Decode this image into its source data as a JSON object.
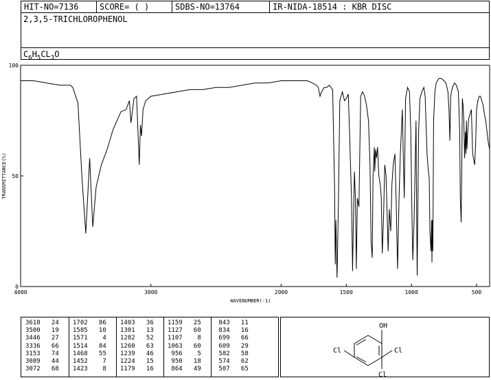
{
  "header": {
    "hit_no": "HIT-NO=7136",
    "score": "SCORE=  (   )",
    "sdbs_no": "SDBS-NO=13764",
    "ir_info": "IR-NIDA-18514 : KBR DISC"
  },
  "compound": {
    "name": "2,3,5-TRICHLOROPHENOL",
    "formula_parts": [
      "C",
      "6",
      "H",
      "5",
      "CL",
      "3",
      "O"
    ]
  },
  "structure": {
    "oh_label": "OH",
    "cl_labels": [
      "Cl",
      "Cl",
      "Cl"
    ]
  },
  "chart_data": {
    "type": "line",
    "title": "",
    "xlabel": "WAVENUMBER(-1)",
    "ylabel": "TRANSMITTANCE(%)",
    "xlim": [
      4000,
      400
    ],
    "ylim": [
      0,
      100
    ],
    "x_ticks": [
      4000,
      3000,
      2000,
      1500,
      1000,
      500
    ],
    "y_ticks": [
      0,
      50,
      100
    ],
    "grid": false,
    "series": [
      {
        "x": [
          4000,
          3900,
          3800,
          3700,
          3650,
          3618,
          3600,
          3560,
          3530,
          3500,
          3470,
          3446,
          3420,
          3380,
          3336,
          3290,
          3230,
          3190,
          3165,
          3153,
          3130,
          3110,
          3089,
          3080,
          3072,
          3060,
          3040,
          3000,
          2900,
          2800,
          2700,
          2600,
          2500,
          2400,
          2300,
          2200,
          2100,
          2000,
          1900,
          1800,
          1760,
          1730,
          1715,
          1702,
          1690,
          1670,
          1650,
          1630,
          1605,
          1590,
          1585,
          1580,
          1575,
          1571,
          1566,
          1560,
          1550,
          1530,
          1514,
          1500,
          1485,
          1475,
          1468,
          1460,
          1452,
          1445,
          1438,
          1430,
          1423,
          1415,
          1403,
          1390,
          1375,
          1360,
          1345,
          1330,
          1318,
          1310,
          1301,
          1295,
          1285,
          1282,
          1275,
          1268,
          1260,
          1250,
          1239,
          1232,
          1224,
          1215,
          1205,
          1195,
          1179,
          1170,
          1159,
          1150,
          1140,
          1127,
          1118,
          1107,
          1095,
          1085,
          1070,
          1063,
          1055,
          1045,
          1030,
          1015,
          1005,
          998,
          990,
          980,
          970,
          965,
          960,
          956,
          952,
          945,
          935,
          920,
          905,
          895,
          880,
          870,
          864,
          858,
          850,
          845,
          843,
          840,
          836,
          834,
          830,
          820,
          810,
          790,
          770,
          750,
          735,
          720,
          712,
          705,
          699,
          693,
          685,
          670,
          655,
          640,
          630,
          625,
          618,
          612,
          609,
          604,
          598,
          592,
          586,
          582,
          578,
          574,
          568,
          560,
          550,
          540,
          530,
          515,
          507,
          500,
          490,
          480,
          470,
          460,
          450,
          440,
          430,
          420,
          410,
          400
        ],
        "y": [
          93,
          93,
          92,
          91,
          91,
          91,
          90,
          83,
          50,
          24,
          58,
          27,
          45,
          55,
          62,
          71,
          79,
          80,
          84,
          74,
          85,
          86,
          55,
          73,
          68,
          80,
          84,
          86,
          87,
          88,
          89,
          89,
          90,
          90,
          91,
          92,
          92,
          93,
          93,
          93,
          92,
          91,
          90,
          86,
          88,
          90,
          90,
          91,
          89,
          45,
          10,
          30,
          15,
          4,
          20,
          40,
          84,
          88,
          84,
          85,
          87,
          70,
          55,
          40,
          7,
          30,
          52,
          40,
          8,
          40,
          36,
          86,
          88,
          86,
          82,
          75,
          55,
          20,
          13,
          50,
          63,
          52,
          62,
          58,
          63,
          50,
          46,
          40,
          15,
          30,
          55,
          50,
          16,
          35,
          25,
          46,
          55,
          60,
          40,
          8,
          40,
          60,
          80,
          60,
          40,
          85,
          90,
          88,
          70,
          40,
          12,
          30,
          60,
          75,
          30,
          5,
          30,
          70,
          85,
          88,
          90,
          86,
          60,
          52,
          49,
          25,
          16,
          30,
          11,
          30,
          16,
          35,
          75,
          88,
          92,
          94,
          94,
          93,
          92,
          88,
          80,
          66,
          86,
          88,
          90,
          92,
          91,
          88,
          70,
          40,
          29,
          65,
          85,
          82,
          75,
          58,
          70,
          60,
          75,
          62,
          70,
          76,
          78,
          80,
          60,
          55,
          65,
          80,
          84,
          86,
          86,
          84,
          82,
          78,
          75,
          70,
          65,
          62
        ]
      }
    ]
  },
  "peaks": [
    [
      [
        "3618",
        "24"
      ],
      [
        "3500",
        "19"
      ],
      [
        "3446",
        "27"
      ],
      [
        "3336",
        "66"
      ],
      [
        "3153",
        "74"
      ],
      [
        "3089",
        "44"
      ],
      [
        "3072",
        "68"
      ]
    ],
    [
      [
        "1702",
        "86"
      ],
      [
        "1585",
        "10"
      ],
      [
        "1571",
        "4"
      ],
      [
        "1514",
        "84"
      ],
      [
        "1468",
        "55"
      ],
      [
        "1452",
        "7"
      ],
      [
        "1423",
        "8"
      ]
    ],
    [
      [
        "1403",
        "36"
      ],
      [
        "1301",
        "13"
      ],
      [
        "1282",
        "52"
      ],
      [
        "1260",
        "63"
      ],
      [
        "1239",
        "46"
      ],
      [
        "1224",
        "15"
      ],
      [
        "1179",
        "16"
      ]
    ],
    [
      [
        "1159",
        "25"
      ],
      [
        "1127",
        "60"
      ],
      [
        "1107",
        "8"
      ],
      [
        "1063",
        "60"
      ],
      [
        "956",
        "5"
      ],
      [
        "950",
        "18"
      ],
      [
        "864",
        "49"
      ]
    ],
    [
      [
        "843",
        "11"
      ],
      [
        "834",
        "16"
      ],
      [
        "699",
        "66"
      ],
      [
        "609",
        "29"
      ],
      [
        "582",
        "58"
      ],
      [
        "574",
        "62"
      ],
      [
        "507",
        "65"
      ]
    ]
  ]
}
